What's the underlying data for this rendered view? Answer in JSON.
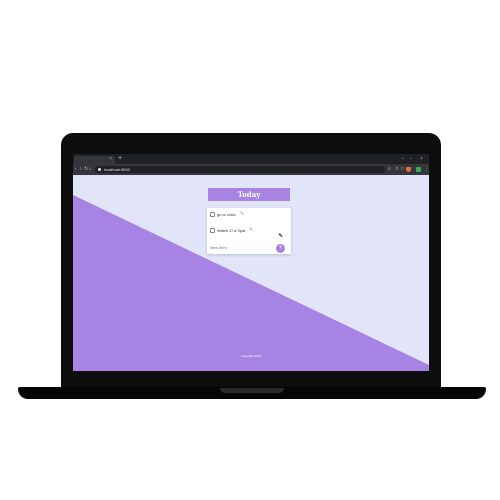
{
  "browser": {
    "tab_close": "×",
    "new_tab": "+",
    "window_min": "–",
    "window_max": "▫",
    "window_close": "×",
    "url": "localhost:3000",
    "nav": {
      "back": "‹",
      "forward": "›",
      "reload": "↻",
      "home": "⌂"
    },
    "toolbar_icons": {
      "search": "⌕",
      "share": "⇧",
      "star": "☆",
      "menu": "⋮"
    }
  },
  "app": {
    "title": "Today",
    "todos": [
      {
        "label": "go to clinic",
        "checked": false
      },
      {
        "label": "Watch Z! a Spai",
        "checked": false
      }
    ],
    "new_todo_placeholder": "New Item",
    "add_label": "+",
    "edit_icon": "✎",
    "footer": "Copyright 2022"
  },
  "colors": {
    "accent": "#a784e3",
    "page_bg": "#e2e5fa",
    "laptop": "#0d0d0d",
    "browser_dark": "#202124"
  },
  "icons": [
    "search-icon",
    "share-icon",
    "star-icon",
    "shield-icon",
    "puzzle-icon",
    "menu-icon",
    "pencil-icon",
    "plus-icon",
    "cursor-icon"
  ]
}
